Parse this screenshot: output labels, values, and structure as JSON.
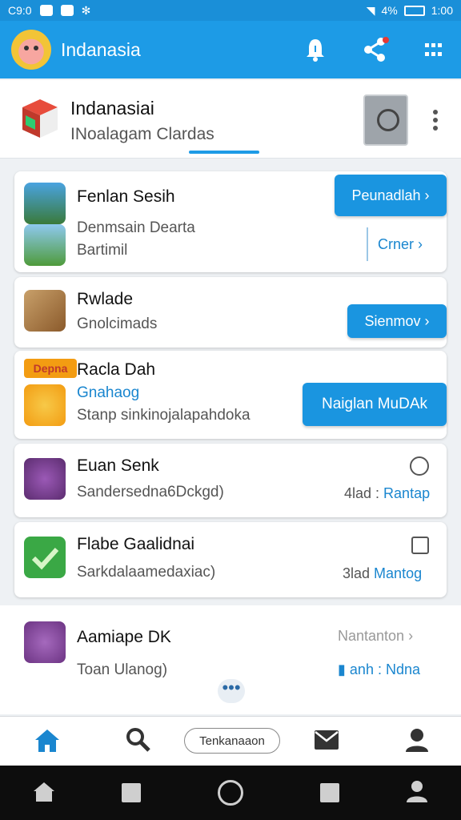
{
  "status_bar": {
    "left": "C9:0",
    "battery_text": "4%",
    "time": "1:00"
  },
  "app_bar": {
    "title": "Indanasia",
    "actions": [
      "bell-icon",
      "share-icon",
      "grid-icon"
    ]
  },
  "header": {
    "title": "Indanasiai",
    "subtitle": "INoalagam Clardas"
  },
  "cards": [
    {
      "rows": [
        {
          "title": "Fenlan Sesih",
          "button": "Peunadlah ›"
        },
        {
          "sub1": "Denmsain Dearta",
          "sub2": "Bartimil",
          "button": "Crner ›"
        }
      ]
    },
    {
      "title": "Rwlade",
      "sub": "Gnolcimads",
      "button": "Sienmov ›"
    },
    {
      "badge": "Depna",
      "title": "Racla Dah",
      "blue": "Gnahaog",
      "sub": "Stanp sinkinojalapahdoka",
      "button": "Naiglan MuDAk"
    },
    {
      "title": "Euan Senk",
      "sub": "Sandersedna6Dckgd)",
      "meta_num": "4lad",
      "meta_link": "Rantap"
    },
    {
      "title": "Flabe Gaalidnai",
      "sub": "Sarkdalaamedaxiac)",
      "meta_num": "3lad",
      "meta_link": "Mantog"
    },
    {
      "title": "Aamiape DK",
      "sub": "Toan Ulanog)",
      "meta_top": "Nantanton ›",
      "meta_num": "anh",
      "meta_link": "Ndna"
    }
  ],
  "bottom_nav": {
    "pill": "Tenkanaaon",
    "items": [
      "home-icon",
      "search-icon",
      "mail-icon",
      "profile-icon"
    ]
  },
  "colors": {
    "primary": "#1d9be6",
    "button": "#1a95e0"
  }
}
